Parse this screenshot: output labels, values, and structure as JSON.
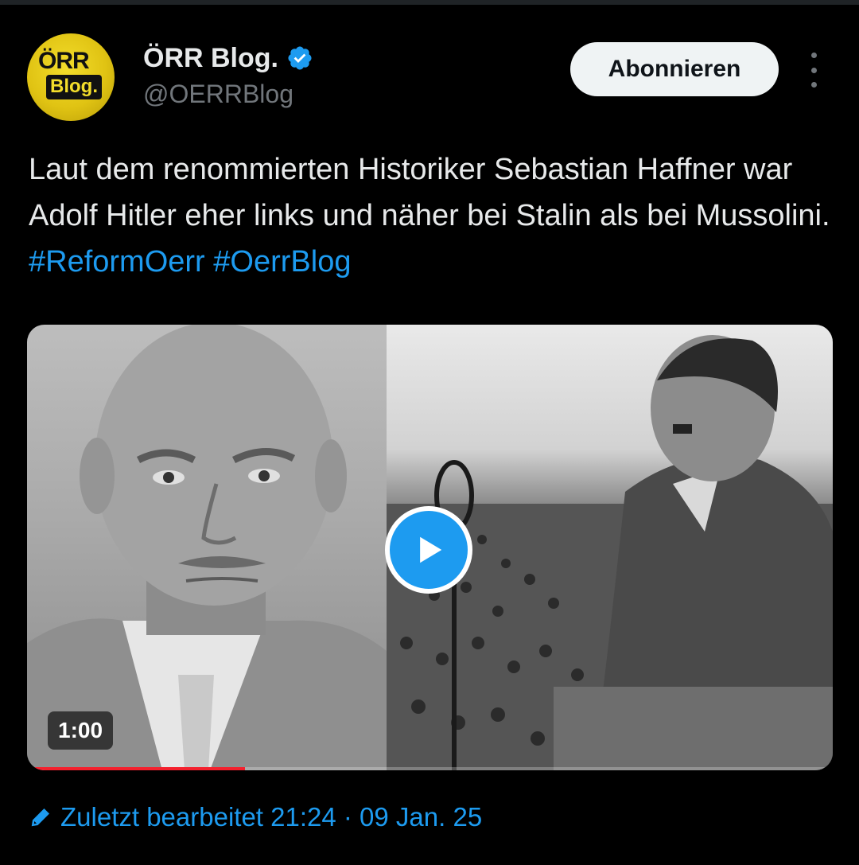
{
  "author": {
    "display_name": "ÖRR Blog.",
    "handle": "@OERRBlog",
    "verified": true,
    "avatar_logo_top": "ÖRR",
    "avatar_logo_bottom": "Blog.",
    "avatar_color": "#e6c916"
  },
  "actions": {
    "follow_label": "Abonnieren",
    "more_icon": "more-vertical-icon"
  },
  "tweet": {
    "text": "Laut dem renommierten Historiker Sebastian Haffner war Adolf Hitler eher links und näher bei Stalin als bei Mussolini.",
    "hashtags": [
      "#ReformOerr",
      "#OerrBlog"
    ]
  },
  "media": {
    "type": "video",
    "duration": "1:00",
    "play_icon": "play-icon",
    "progress": 0.27
  },
  "footer": {
    "edited_icon": "pencil-icon",
    "edited_text": "Zuletzt bearbeitet 21:24 · 09 Jan. 25"
  },
  "colors": {
    "background": "#000000",
    "text": "#e7e9ea",
    "secondary_text": "#71767b",
    "accent": "#1d9bf0",
    "button_bg": "#eff3f4",
    "progress": "#f4212e"
  }
}
